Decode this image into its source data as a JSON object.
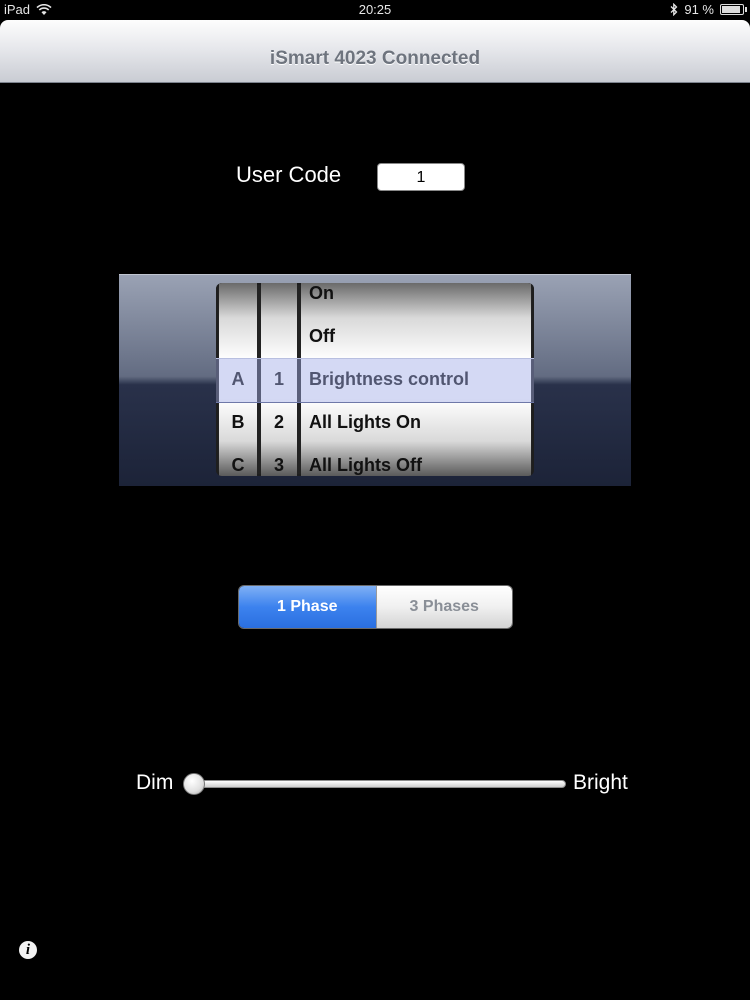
{
  "status_bar": {
    "device": "iPad",
    "time": "20:25",
    "battery_text": "91 %",
    "battery_level": 0.91,
    "icons": [
      "wifi-icon",
      "bluetooth-icon",
      "battery-icon"
    ]
  },
  "nav": {
    "title": "iSmart 4023 Connected"
  },
  "user_code": {
    "label": "User Code",
    "value": "1"
  },
  "picker": {
    "col1": [
      "",
      "",
      "A",
      "B",
      "C"
    ],
    "col2": [
      "",
      "",
      "1",
      "2",
      "3"
    ],
    "col3": [
      "On",
      "Off",
      "Brightness control",
      "All Lights On",
      "All Lights Off"
    ],
    "selected": {
      "col1": "A",
      "col2": "1",
      "col3": "Brightness control"
    }
  },
  "phase": {
    "options": [
      "1 Phase",
      "3 Phases"
    ],
    "selected": "1 Phase"
  },
  "brightness": {
    "min_label": "Dim",
    "max_label": "Bright",
    "value": 0.0
  },
  "info": {
    "icon": "info-icon",
    "glyph": "i"
  },
  "colors": {
    "background": "#000000",
    "segment_selected": "#3c82ee",
    "picker_selection": "#a0aae6"
  }
}
